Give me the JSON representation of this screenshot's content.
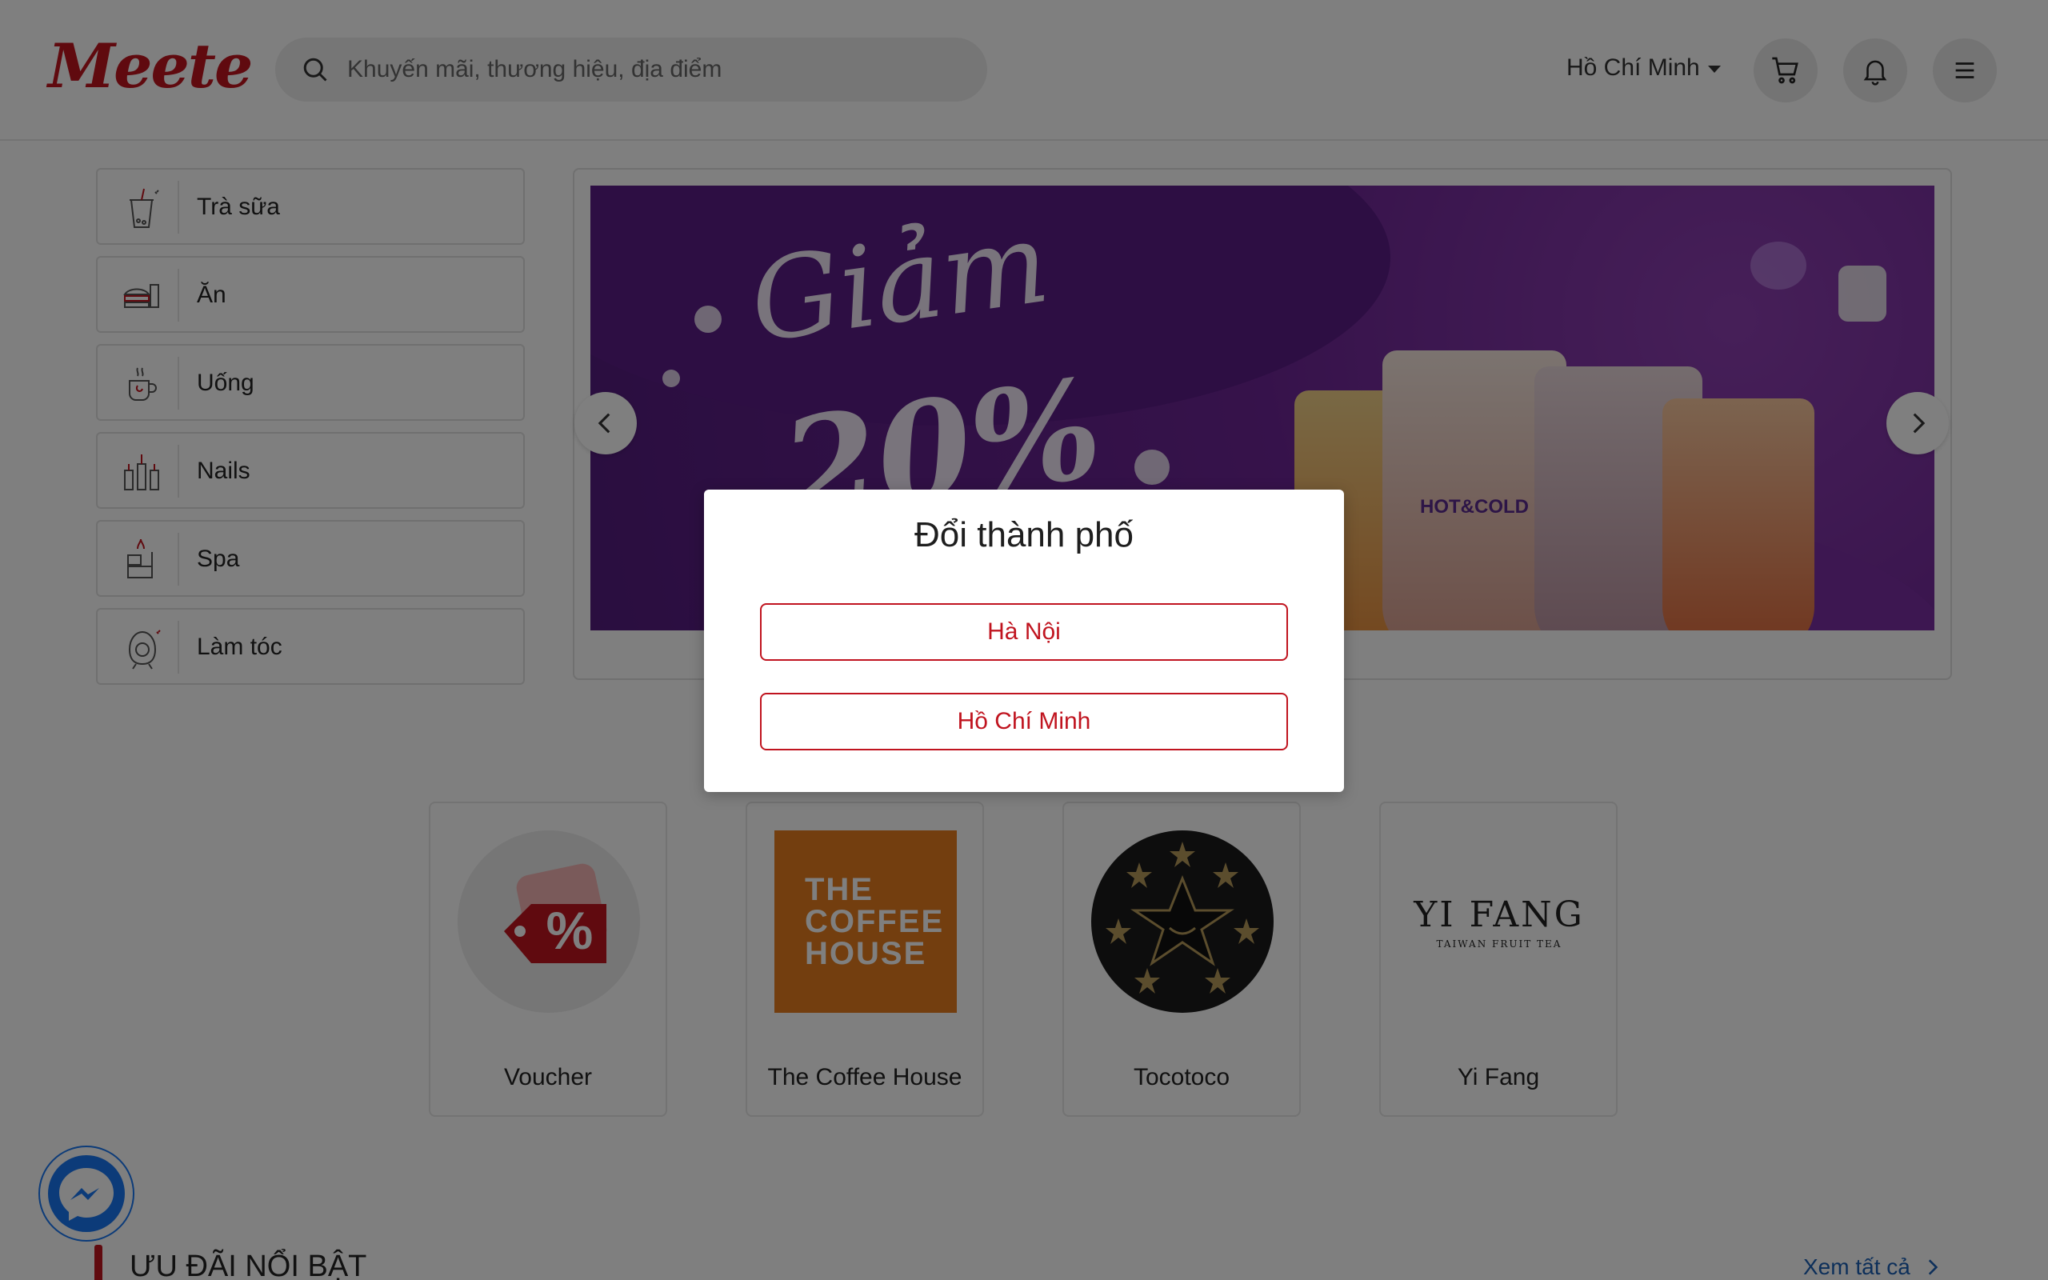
{
  "header": {
    "logo_text": "Meete",
    "search": {
      "placeholder": "Khuyến mãi, thương hiệu, địa điểm"
    },
    "city_label": "Hồ Chí Minh",
    "icons": [
      "search-icon",
      "cart-icon",
      "bell-icon",
      "hamburger-menu-icon"
    ]
  },
  "categories": [
    {
      "label": "Trà sữa",
      "icon": "milk-tea-icon"
    },
    {
      "label": "Ăn",
      "icon": "food-icon"
    },
    {
      "label": "Uống",
      "icon": "drink-icon"
    },
    {
      "label": "Nails",
      "icon": "nails-icon"
    },
    {
      "label": "Spa",
      "icon": "spa-icon"
    },
    {
      "label": "Làm tóc",
      "icon": "hair-icon"
    }
  ],
  "banner": {
    "promo_text": "Giảm",
    "promo_value": "20%",
    "brand_on_cups": "HOT&COLD",
    "active_slide": 1,
    "slide_count": 2
  },
  "brands": [
    {
      "name": "Voucher",
      "icon": "voucher-icon",
      "badge": "%"
    },
    {
      "name": "The Coffee House",
      "logo_lines": [
        "THE",
        "COFFEE",
        "HOUSE"
      ]
    },
    {
      "name": "Tocotoco"
    },
    {
      "name": "Yi Fang",
      "logo_title": "YI FANG",
      "logo_sub": "TAIWAN FRUIT TEA"
    }
  ],
  "section": {
    "title": "ƯU ĐÃI NỔI BẬT",
    "see_all": "Xem tất cả"
  },
  "modal": {
    "title": "Đổi thành phố",
    "options": [
      "Hà Nội",
      "Hồ Chí Minh"
    ]
  },
  "colors": {
    "brand_red": "#c0141f",
    "link_blue": "#1a5fb4",
    "messenger_blue": "#1877f2",
    "overlay": "rgba(0,0,0,0.5)"
  }
}
